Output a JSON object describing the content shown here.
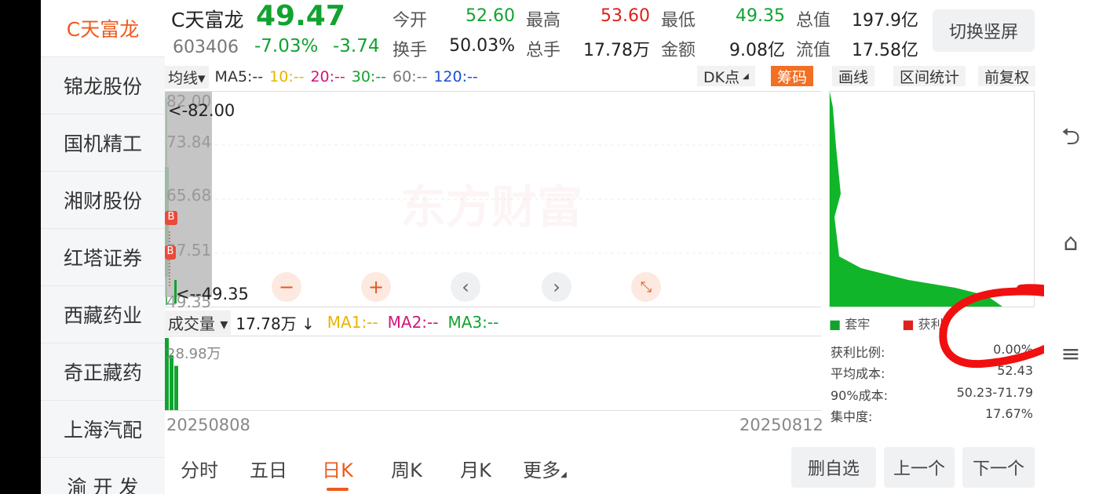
{
  "sidebar": {
    "items": [
      "C天富龙",
      "锦龙股份",
      "国机精工",
      "湘财股份",
      "红塔证券",
      "西藏药业",
      "奇正藏药",
      "上海汽配",
      "渝 开 发"
    ]
  },
  "quote": {
    "name": "C天富龙",
    "price": "49.47",
    "code": "603406",
    "pct": "-7.03%",
    "change": "-3.74",
    "open_label": "今开",
    "open": "52.60",
    "high_label": "最高",
    "high": "53.60",
    "low_label": "最低",
    "low": "49.35",
    "mcap_label": "总值",
    "mcap": "197.9亿",
    "turnover_label": "换手",
    "turnover": "50.03%",
    "vol_label": "总手",
    "vol": "17.78万",
    "amount_label": "金额",
    "amount": "9.08亿",
    "float_label": "流值",
    "float": "17.58亿",
    "switch_button": "切换竖屏"
  },
  "ma_bar": {
    "type": "均线▾",
    "ma5": "MA5:--",
    "ma10": "10:--",
    "ma20": "20:--",
    "ma30": "30:--",
    "ma60": "60:--",
    "ma120": "120:--",
    "dk": "DK点",
    "chips": "筹码",
    "draw": "画线",
    "range": "区间统计",
    "adjust": "前复权"
  },
  "chart": {
    "y_labels": [
      "82.00",
      "73.84",
      "65.68",
      "57.51",
      "49.35"
    ],
    "high_annot": "<-82.00",
    "low_annot": "<--49.35",
    "watermark": "东方财富",
    "b_marker": "B"
  },
  "volume": {
    "selector": "成交量 ▾",
    "value": "17.78万 ↓",
    "ma1": "MA1:--",
    "ma2": "MA2:--",
    "ma3": "MA3:--",
    "max_label": "28.98万",
    "bars": [
      28.98,
      22.0,
      17.78
    ]
  },
  "dates": {
    "start": "20250808",
    "end": "20250812"
  },
  "chip_panel": {
    "legend_trapped": "套牢",
    "legend_profit": "获利",
    "stats": [
      {
        "label": "获利比例:",
        "value": "0.00%"
      },
      {
        "label": "平均成本:",
        "value": "52.43"
      },
      {
        "label": "90%成本:",
        "value": "50.23-71.79"
      },
      {
        "label": "集中度:",
        "value": "17.67%"
      }
    ]
  },
  "tabs": [
    "分时",
    "五日",
    "日K",
    "周K",
    "月K",
    "更多"
  ],
  "buttons": {
    "delete": "删自选",
    "prev": "上一个",
    "next": "下一个"
  },
  "colors": {
    "accent": "#ee5a1e",
    "up": "#e0201c",
    "down": "#11a330"
  }
}
